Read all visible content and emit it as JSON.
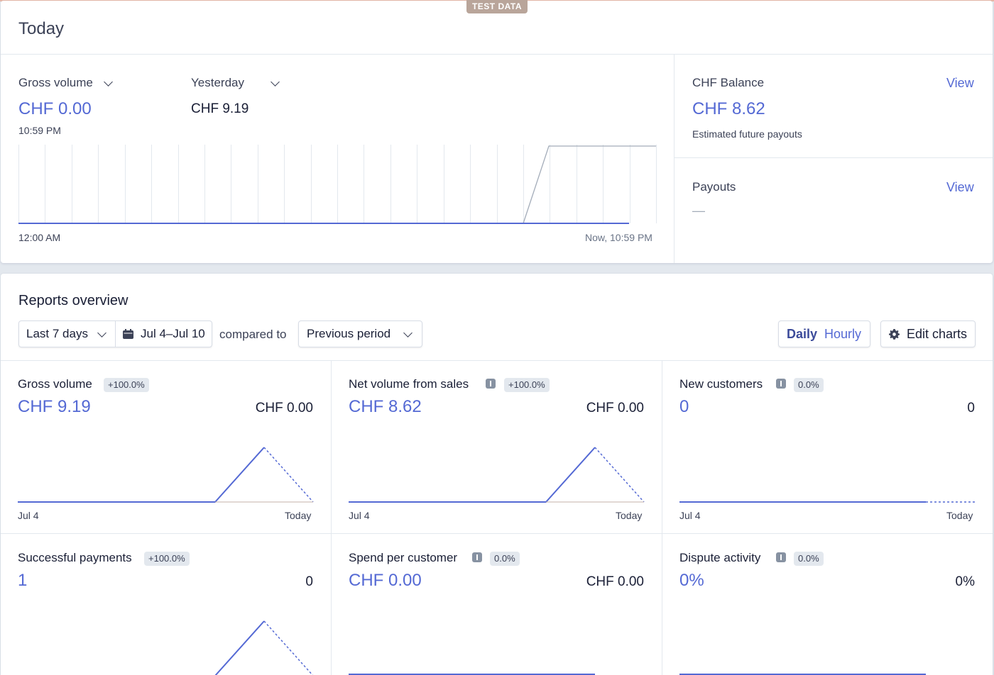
{
  "badge": "TEST DATA",
  "today": {
    "title": "Today",
    "gross_volume_label": "Gross volume",
    "gross_volume_value": "CHF 0.00",
    "time": "10:59 PM",
    "compare_label": "Yesterday",
    "compare_value": "CHF 9.19",
    "axis_start": "12:00 AM",
    "axis_end": "Now, 10:59 PM",
    "balance": {
      "label": "CHF Balance",
      "link": "View",
      "value": "CHF 8.62",
      "sub": "Estimated future payouts"
    },
    "payouts": {
      "label": "Payouts",
      "link": "View",
      "value": "—"
    }
  },
  "reports": {
    "title": "Reports overview",
    "range_select": "Last 7 days",
    "date_range": "Jul 4–Jul 10",
    "compared_to": "compared to",
    "compare_select": "Previous period",
    "toggle": {
      "daily": "Daily",
      "hourly": "Hourly",
      "active": "Daily"
    },
    "edit_charts": "Edit charts",
    "cells": [
      {
        "title": "Gross volume",
        "info": false,
        "change": "+100.0%",
        "value": "CHF 9.19",
        "previous": "CHF 0.00",
        "axis_start": "Jul 4",
        "axis_end": "Today"
      },
      {
        "title": "Net volume from sales",
        "info": true,
        "change": "+100.0%",
        "value": "CHF 8.62",
        "previous": "CHF 0.00",
        "axis_start": "Jul 4",
        "axis_end": "Today"
      },
      {
        "title": "New customers",
        "info": true,
        "change": "0.0%",
        "value": "0",
        "previous": "0",
        "axis_start": "Jul 4",
        "axis_end": "Today"
      },
      {
        "title": "Successful payments",
        "info": false,
        "change": "+100.0%",
        "value": "1",
        "previous": "0"
      },
      {
        "title": "Spend per customer",
        "info": true,
        "change": "0.0%",
        "value": "CHF 0.00",
        "previous": "CHF 0.00"
      },
      {
        "title": "Dispute activity",
        "info": true,
        "change": "0.0%",
        "value": "0%",
        "previous": "0%"
      }
    ]
  },
  "colors": {
    "accent": "#5469d4",
    "border": "#e3e8ee",
    "text": "#1a1f36",
    "badge": "#b9a59a"
  },
  "icons": {
    "calendar": "calendar-icon",
    "gear": "gear-icon",
    "info": "info-icon",
    "chevron": "chevron-down-icon"
  }
}
